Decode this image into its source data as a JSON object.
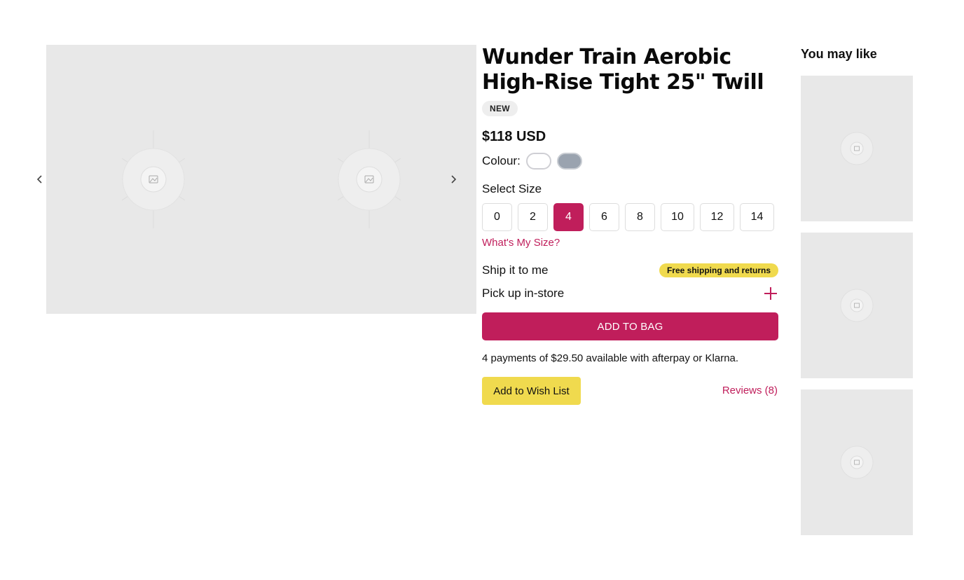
{
  "product": {
    "title": "Wunder Train Aerobic High-Rise Tight 25\" Twill",
    "badge": "NEW",
    "price": "$118 USD",
    "colour_label": "Colour:",
    "colours": [
      "white",
      "grey"
    ],
    "size_label": "Select Size",
    "sizes": [
      "0",
      "2",
      "4",
      "6",
      "8",
      "10",
      "12",
      "14"
    ],
    "selected_size": "4",
    "size_guide_link": "What's My Size?"
  },
  "fulfillment": {
    "ship_label": "Ship it to me",
    "ship_badge": "Free shipping and returns",
    "pickup_label": "Pick up in-store"
  },
  "actions": {
    "add_to_bag": "ADD TO BAG",
    "payments_text": "4 payments of $29.50 available with afterpay or Klarna.",
    "wish_list": "Add to Wish List",
    "reviews": "Reviews (8)"
  },
  "recommendations": {
    "title": "You may like"
  },
  "colors": {
    "accent": "#c01e5b",
    "highlight": "#f0da4e",
    "placeholder_bg": "#e8e8e8",
    "swatch_grey": "#9aa3af"
  }
}
